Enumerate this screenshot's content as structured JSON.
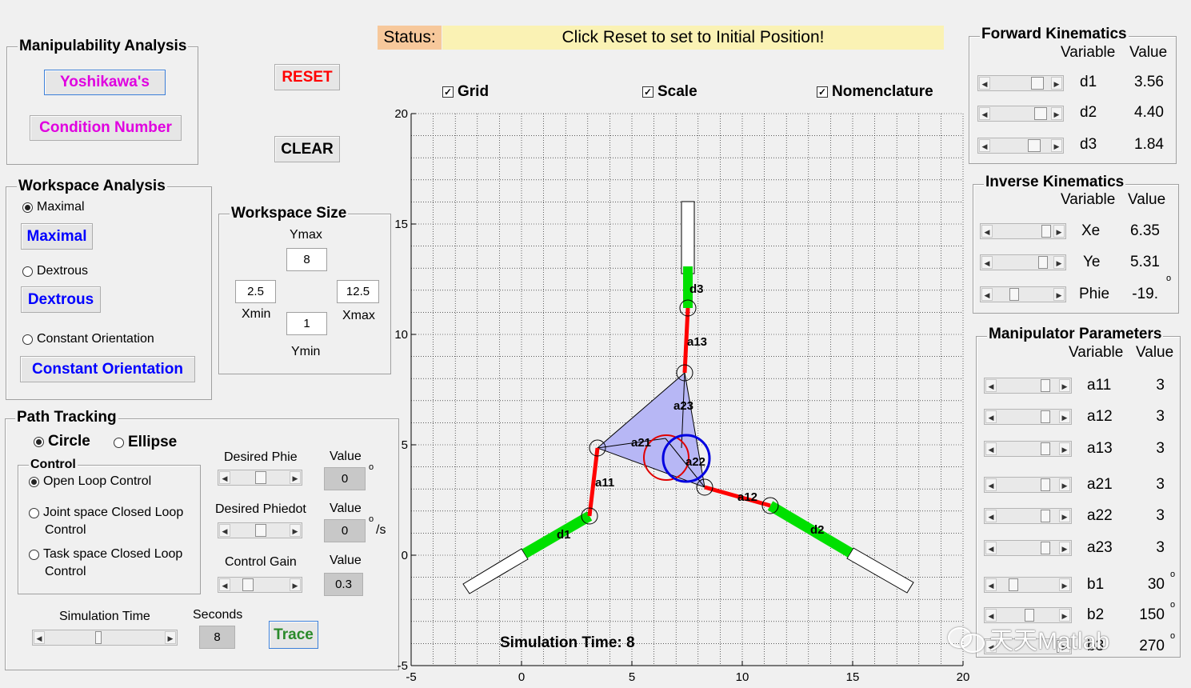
{
  "status": {
    "label": "Status:",
    "message": "Click Reset to set to Initial Position!"
  },
  "manipulability": {
    "title": "Manipulability Analysis",
    "yoshikawa_label": "Yoshikawa's",
    "condition_label": "Condition Number"
  },
  "buttons": {
    "reset_label": "RESET",
    "clear_label": "CLEAR",
    "trace_label": "Trace"
  },
  "workspace": {
    "title": "Workspace Analysis",
    "radios": [
      {
        "label": "Maximal",
        "selected": true
      },
      {
        "label": "Dextrous",
        "selected": false
      },
      {
        "label": "Constant Orientation",
        "selected": false
      }
    ],
    "buttons": [
      "Maximal",
      "Dextrous",
      "Constant Orientation"
    ]
  },
  "workspace_size": {
    "title": "Workspace Size",
    "ymax_label": "Ymax",
    "ymax": "8",
    "xmin_label": "Xmin",
    "xmin": "2.5",
    "xmax_label": "Xmax",
    "xmax": "12.5",
    "ymin_label": "Ymin",
    "ymin": "1"
  },
  "path_tracking": {
    "title": "Path Tracking",
    "shape_radios": [
      {
        "label": "Circle",
        "selected": true
      },
      {
        "label": "Ellipse",
        "selected": false
      }
    ],
    "control_title": "Control",
    "control_radios": [
      {
        "label": "Open Loop Control",
        "selected": true
      },
      {
        "label": "Joint space Closed Loop",
        "label2": "Control",
        "selected": false
      },
      {
        "label": "Task space Closed Loop",
        "label2": "Control",
        "selected": false
      }
    ],
    "desired_phie_label": "Desired Phie",
    "desired_phiedot_label": "Desired Phiedot",
    "control_gain_label": "Control Gain",
    "value_label": "Value",
    "phie_value": "0",
    "phiedot_value": "0",
    "gain_value": "0.3",
    "deg_symbol": "o",
    "per_second": "/s",
    "sim_time_label": "Simulation Time",
    "seconds_label": "Seconds",
    "seconds_value": "8"
  },
  "toggles": {
    "grid": "Grid",
    "scale": "Scale",
    "nomenclature": "Nomenclature"
  },
  "forward_kinematics": {
    "title": "Forward Kinematics",
    "col_variable": "Variable",
    "col_value": "Value",
    "rows": [
      {
        "name": "d1",
        "value": "3.56"
      },
      {
        "name": "d2",
        "value": "4.40"
      },
      {
        "name": "d3",
        "value": "1.84"
      }
    ]
  },
  "inverse_kinematics": {
    "title": "Inverse Kinematics",
    "col_variable": "Variable",
    "col_value": "Value",
    "rows": [
      {
        "name": "Xe",
        "value": "6.35"
      },
      {
        "name": "Ye",
        "value": "5.31"
      },
      {
        "name": "Phie",
        "value": "-19."
      }
    ]
  },
  "manipulator_params": {
    "title": "Manipulator Parameters",
    "col_variable": "Variable",
    "col_value": "Value",
    "rows": [
      {
        "name": "a11",
        "value": "3"
      },
      {
        "name": "a12",
        "value": "3"
      },
      {
        "name": "a13",
        "value": "3"
      },
      {
        "name": "a21",
        "value": "3"
      },
      {
        "name": "a22",
        "value": "3"
      },
      {
        "name": "a23",
        "value": "3"
      },
      {
        "name": "b1",
        "value": "30"
      },
      {
        "name": "b2",
        "value": "150"
      },
      {
        "name": "b3",
        "value": "270"
      }
    ]
  },
  "plot": {
    "xticks": [
      "-5",
      "0",
      "5",
      "10",
      "15",
      "20"
    ],
    "yticks": [
      "-5",
      "0",
      "5",
      "10",
      "15",
      "20"
    ],
    "sim_time_text": "Simulation Time: 8",
    "labels": {
      "d1": "d1",
      "d2": "d2",
      "d3": "d3",
      "a11": "a11",
      "a12": "a12",
      "a13": "a13",
      "a21": "a21",
      "a22": "a22",
      "a23": "a23"
    }
  },
  "watermark": "天天Matlab",
  "colors": {
    "link": "#ff0000",
    "prismatic": "#00e000",
    "platform": "#b7b7f5",
    "circle_red": "#e00000",
    "circle_blue": "#0000e0",
    "status_bg": "#faf2b4",
    "status_label_bg": "#f7c89b"
  }
}
